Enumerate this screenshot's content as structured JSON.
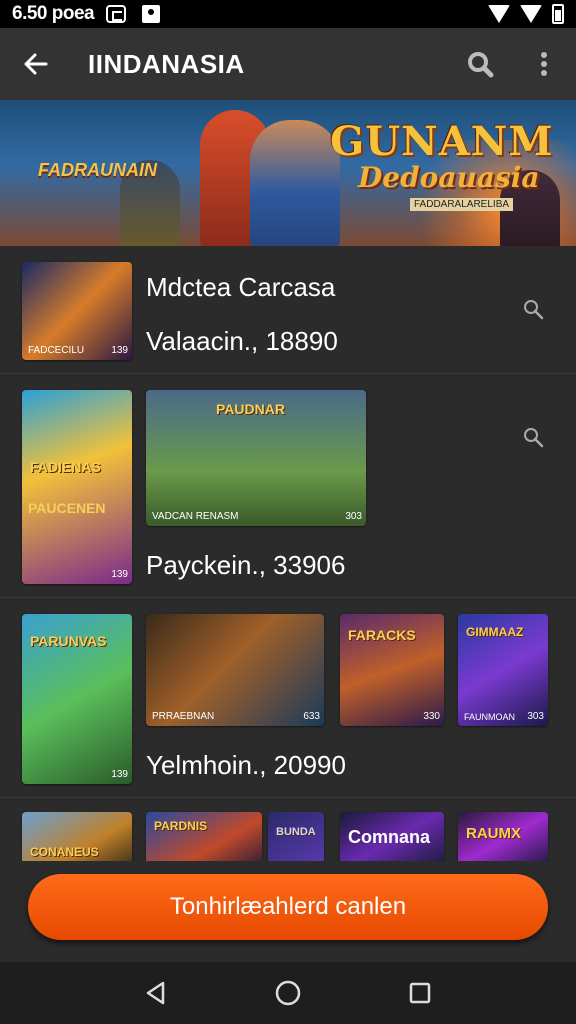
{
  "status_bar": {
    "time": "6.50 poea"
  },
  "app_bar": {
    "title": "IINDANASIA"
  },
  "hero": {
    "left_text": "FADRAUNAIN",
    "logo_line1": "GUNANM",
    "logo_line2": "Dedoauasia",
    "logo_line3": "FADDARALARELIBA"
  },
  "rows": [
    {
      "title": "Mdctea Carcasa",
      "subtitle": "Valaacin., 18890",
      "thumbs": [
        {
          "tag": "FADCECILU",
          "num": "139"
        }
      ]
    },
    {
      "subtitle": "Payckein., 33906",
      "thumbs": [
        {
          "title": "FADIENAS",
          "tag": "PAUCENEN",
          "num": "139"
        },
        {
          "title": "PAUDNAR",
          "tag": "VADCAN RENASM",
          "num": "303"
        }
      ]
    },
    {
      "subtitle": "Yelmhoin., 20990",
      "thumbs": [
        {
          "title": "PARUNVAS",
          "tag": "",
          "num": "139"
        },
        {
          "title": "",
          "tag": "PRRAEBNAN",
          "num": "633"
        },
        {
          "title": "FARACKS",
          "tag": "",
          "num": "330"
        },
        {
          "title": "GIMMAAZ",
          "tag": "FAUNMOAN",
          "num": "303"
        }
      ]
    },
    {
      "thumbs": [
        {
          "title": "CONANEUS"
        },
        {
          "title": "PARDNIS"
        },
        {
          "title": "BUNDA"
        },
        {
          "title": "Comnana"
        },
        {
          "title": "RAUMX"
        }
      ]
    }
  ],
  "cta": {
    "label": "Tonhirlæahlerd canlen"
  }
}
